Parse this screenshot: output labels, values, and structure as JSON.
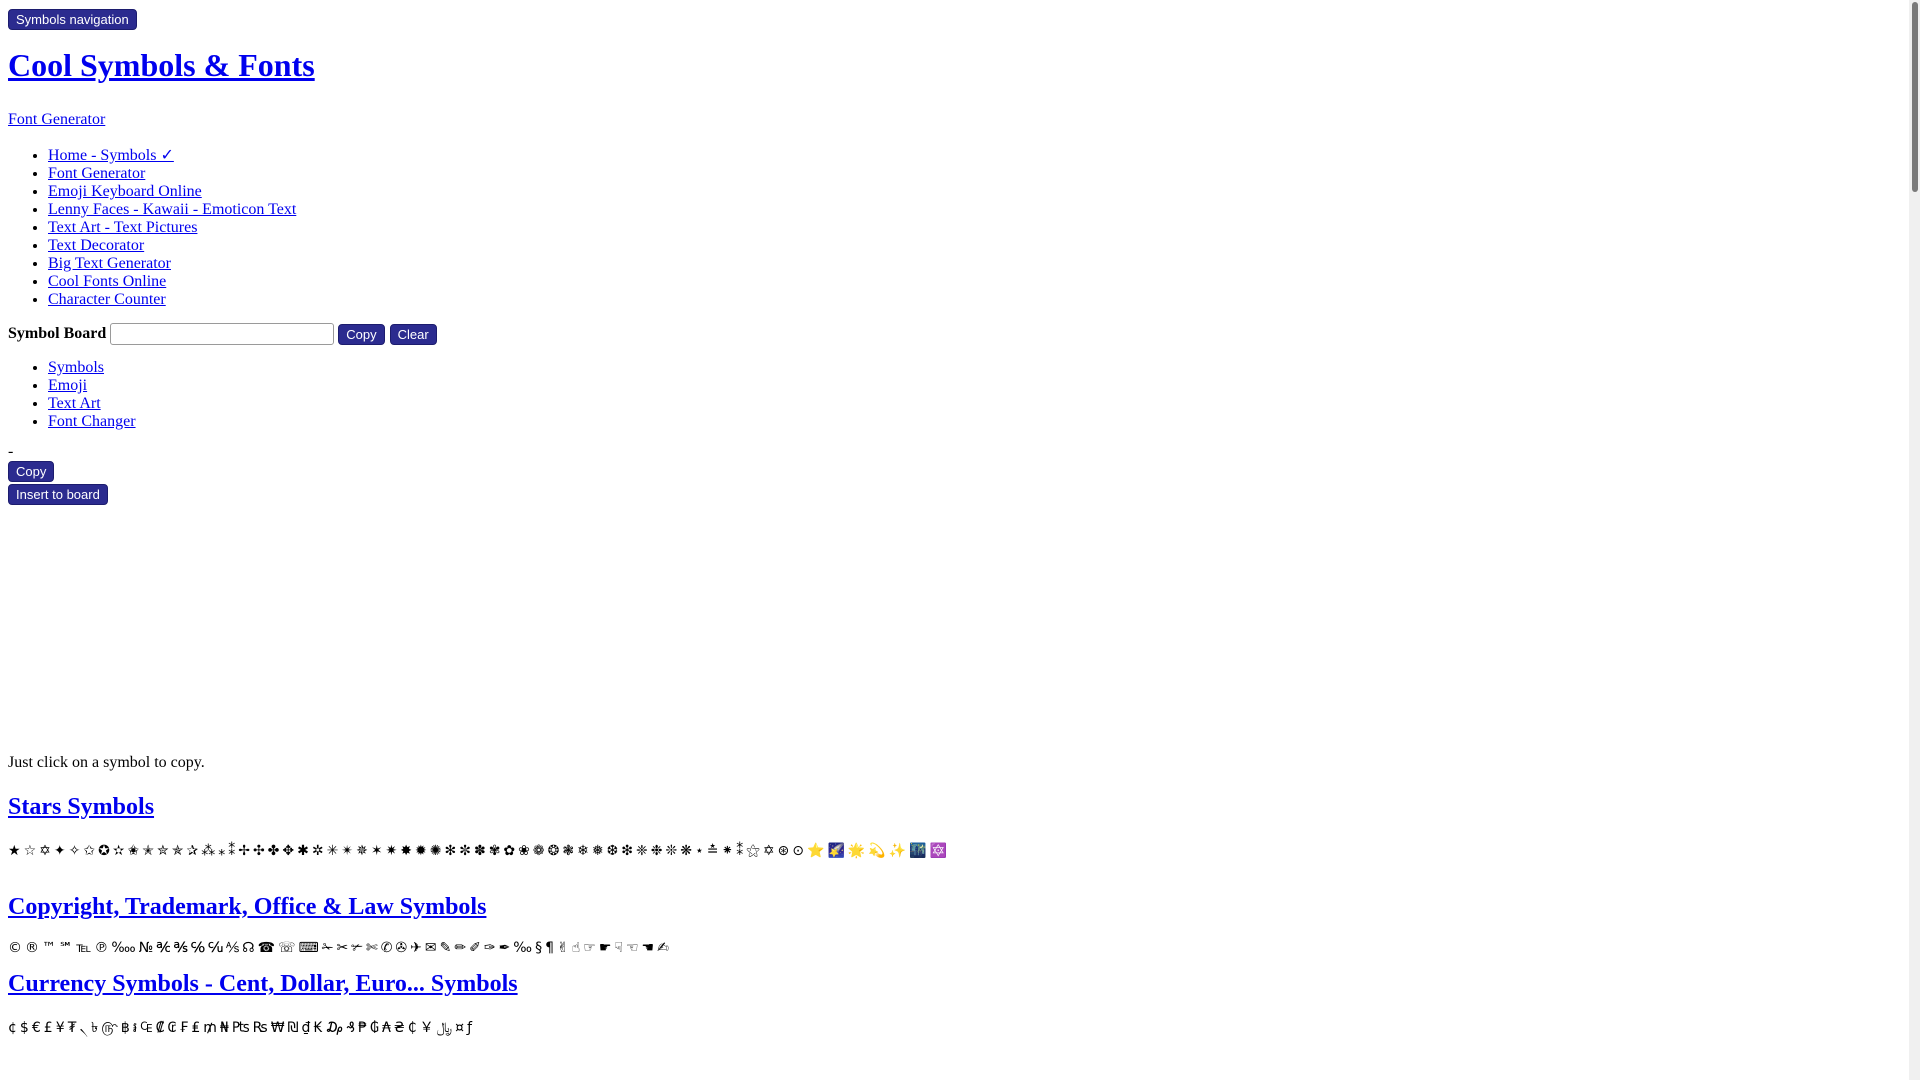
{
  "skip_nav_label": "Symbols navigation",
  "site_title": "Cool Symbols & Fonts",
  "font_generator_link": "Font Generator",
  "main_nav": [
    "Home - Symbols ✓",
    "Font Generator",
    "Emoji Keyboard Online",
    "Lenny Faces - Kawaii - Emoticon Text",
    "Text Art - Text Pictures",
    "Text Decorator",
    "Big Text Generator",
    "Cool Fonts Online",
    "Character Counter"
  ],
  "symbol_board": {
    "label": "Symbol Board",
    "value": "",
    "copy_label": "Copy",
    "clear_label": "Clear"
  },
  "tabs": [
    "Symbols",
    "Emoji",
    "Text Art",
    "Font Changer"
  ],
  "selected_preview": "-",
  "copy_label": "Copy",
  "insert_label": "Insert to board",
  "hint": "Just click on a symbol to copy.",
  "sections": [
    {
      "title": "Stars Symbols",
      "symbols": [
        "★",
        "☆",
        "✡",
        "✦",
        "✧",
        "✩",
        "✪",
        "✫",
        "✬",
        "✭",
        "✮",
        "✯",
        "✰",
        "⁂",
        "⁎",
        "⁑",
        "✢",
        "✣",
        "✤",
        "✥",
        "✱",
        "✲",
        "✳",
        "✴",
        "✵",
        "✶",
        "✷",
        "✸",
        "✹",
        "✺",
        "✻",
        "✼",
        "✽",
        "✾",
        "✿",
        "❀",
        "❁",
        "❂",
        "❃",
        "❄",
        "❅",
        "❆",
        "❇",
        "❈",
        "❉",
        "❊",
        "❋",
        "⋆",
        "≛",
        "⁕",
        "⁑",
        "⚝",
        "✡",
        "⊛",
        "⊙",
        "⭐",
        "🌠",
        "🌟",
        "💫",
        "✨",
        "🌃",
        "🔯"
      ]
    },
    {
      "title": "Copyright, Trademark, Office & Law Symbols",
      "symbols": [
        "©",
        "®",
        "™",
        "℠",
        "℡",
        "℗",
        "‱",
        "№",
        "℀",
        "℁",
        "℅",
        "℆",
        "⅍",
        "☊",
        "☎",
        "☏",
        "⌨",
        "✁",
        "✂",
        "✃",
        "✄",
        "✆",
        "✇",
        "✈",
        "✉",
        "✎",
        "✏",
        "✐",
        "✑",
        "✒",
        "‰",
        "§",
        "¶",
        "✌",
        "☝",
        "☞",
        "☛",
        "☟",
        "☜",
        "☚",
        "✍"
      ]
    },
    {
      "title": "Currency Symbols - Cent, Dollar, Euro... Symbols",
      "symbols": [
        "¢",
        "$",
        "€",
        "£",
        "¥",
        "₮",
        "৲",
        "৳",
        "௹",
        "฿",
        "៛",
        "₠",
        "₡",
        "₢",
        "₣",
        "₤",
        "₥",
        "₦",
        "₧",
        "₨",
        "₩",
        "₪",
        "₫",
        "₭",
        "₯",
        "₰",
        "₱",
        "₲",
        "₳",
        "₴",
        "₵",
        "￥",
        "﷼",
        "¤",
        "ƒ"
      ]
    }
  ],
  "colors": {
    "button_bg": "#2b2b8f",
    "link": "#0000ee"
  }
}
